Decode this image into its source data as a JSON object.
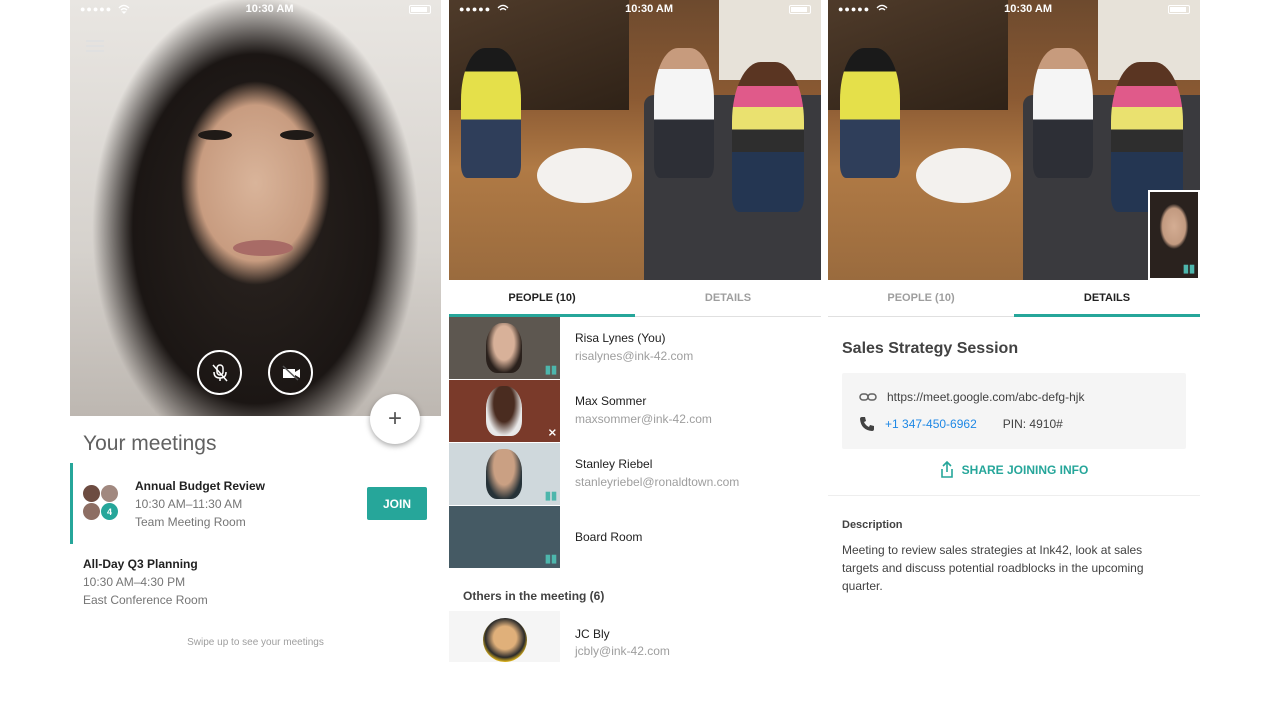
{
  "status_bar": {
    "time": "10:30 AM",
    "signal": "●●●●●"
  },
  "panel1": {
    "meetings_title": "Your meetings",
    "add_button": "+",
    "meeting1": {
      "title": "Annual Budget Review",
      "time": "10:30 AM–11:30 AM",
      "room": "Team Meeting Room",
      "join_label": "JOIN",
      "extra_attendees": "4"
    },
    "meeting2": {
      "title": "All-Day Q3 Planning",
      "time": "10:30 AM–4:30 PM",
      "room": "East Conference Room"
    },
    "swipe_hint": "Swipe up to see your meetings"
  },
  "panel2": {
    "tabs": [
      {
        "label": "PEOPLE (10)"
      },
      {
        "label": "DETAILS"
      }
    ],
    "people": [
      {
        "name": "Risa Lynes (You)",
        "email": "risalynes@ink-42.com"
      },
      {
        "name": "Max Sommer",
        "email": "maxsommer@ink-42.com"
      },
      {
        "name": "Stanley Riebel",
        "email": "stanleyriebel@ronaldtown.com"
      },
      {
        "name": "Board Room",
        "email": ""
      }
    ],
    "others_label": "Others in the meeting  (6)",
    "others": [
      {
        "name": "JC Bly",
        "email": "jcbly@ink-42.com"
      }
    ]
  },
  "panel3": {
    "tabs": [
      {
        "label": "PEOPLE (10)"
      },
      {
        "label": "DETAILS"
      }
    ],
    "title": "Sales Strategy Session",
    "link": "https://meet.google.com/abc-defg-hjk",
    "phone": "+1 347-450-6962",
    "pin": "PIN: 4910#",
    "share_label": "SHARE JOINING INFO",
    "description_label": "Description",
    "description": "Meeting to review sales strategies at Ink42, look at sales targets and discuss potential roadblocks in the upcoming quarter."
  },
  "colors": {
    "accent": "#26a69a",
    "link": "#1e88e5"
  },
  "icons": [
    "menu-icon",
    "mic-off-icon",
    "camera-off-icon",
    "add-icon",
    "audio-level-icon",
    "link-icon",
    "phone-icon",
    "share-icon"
  ]
}
